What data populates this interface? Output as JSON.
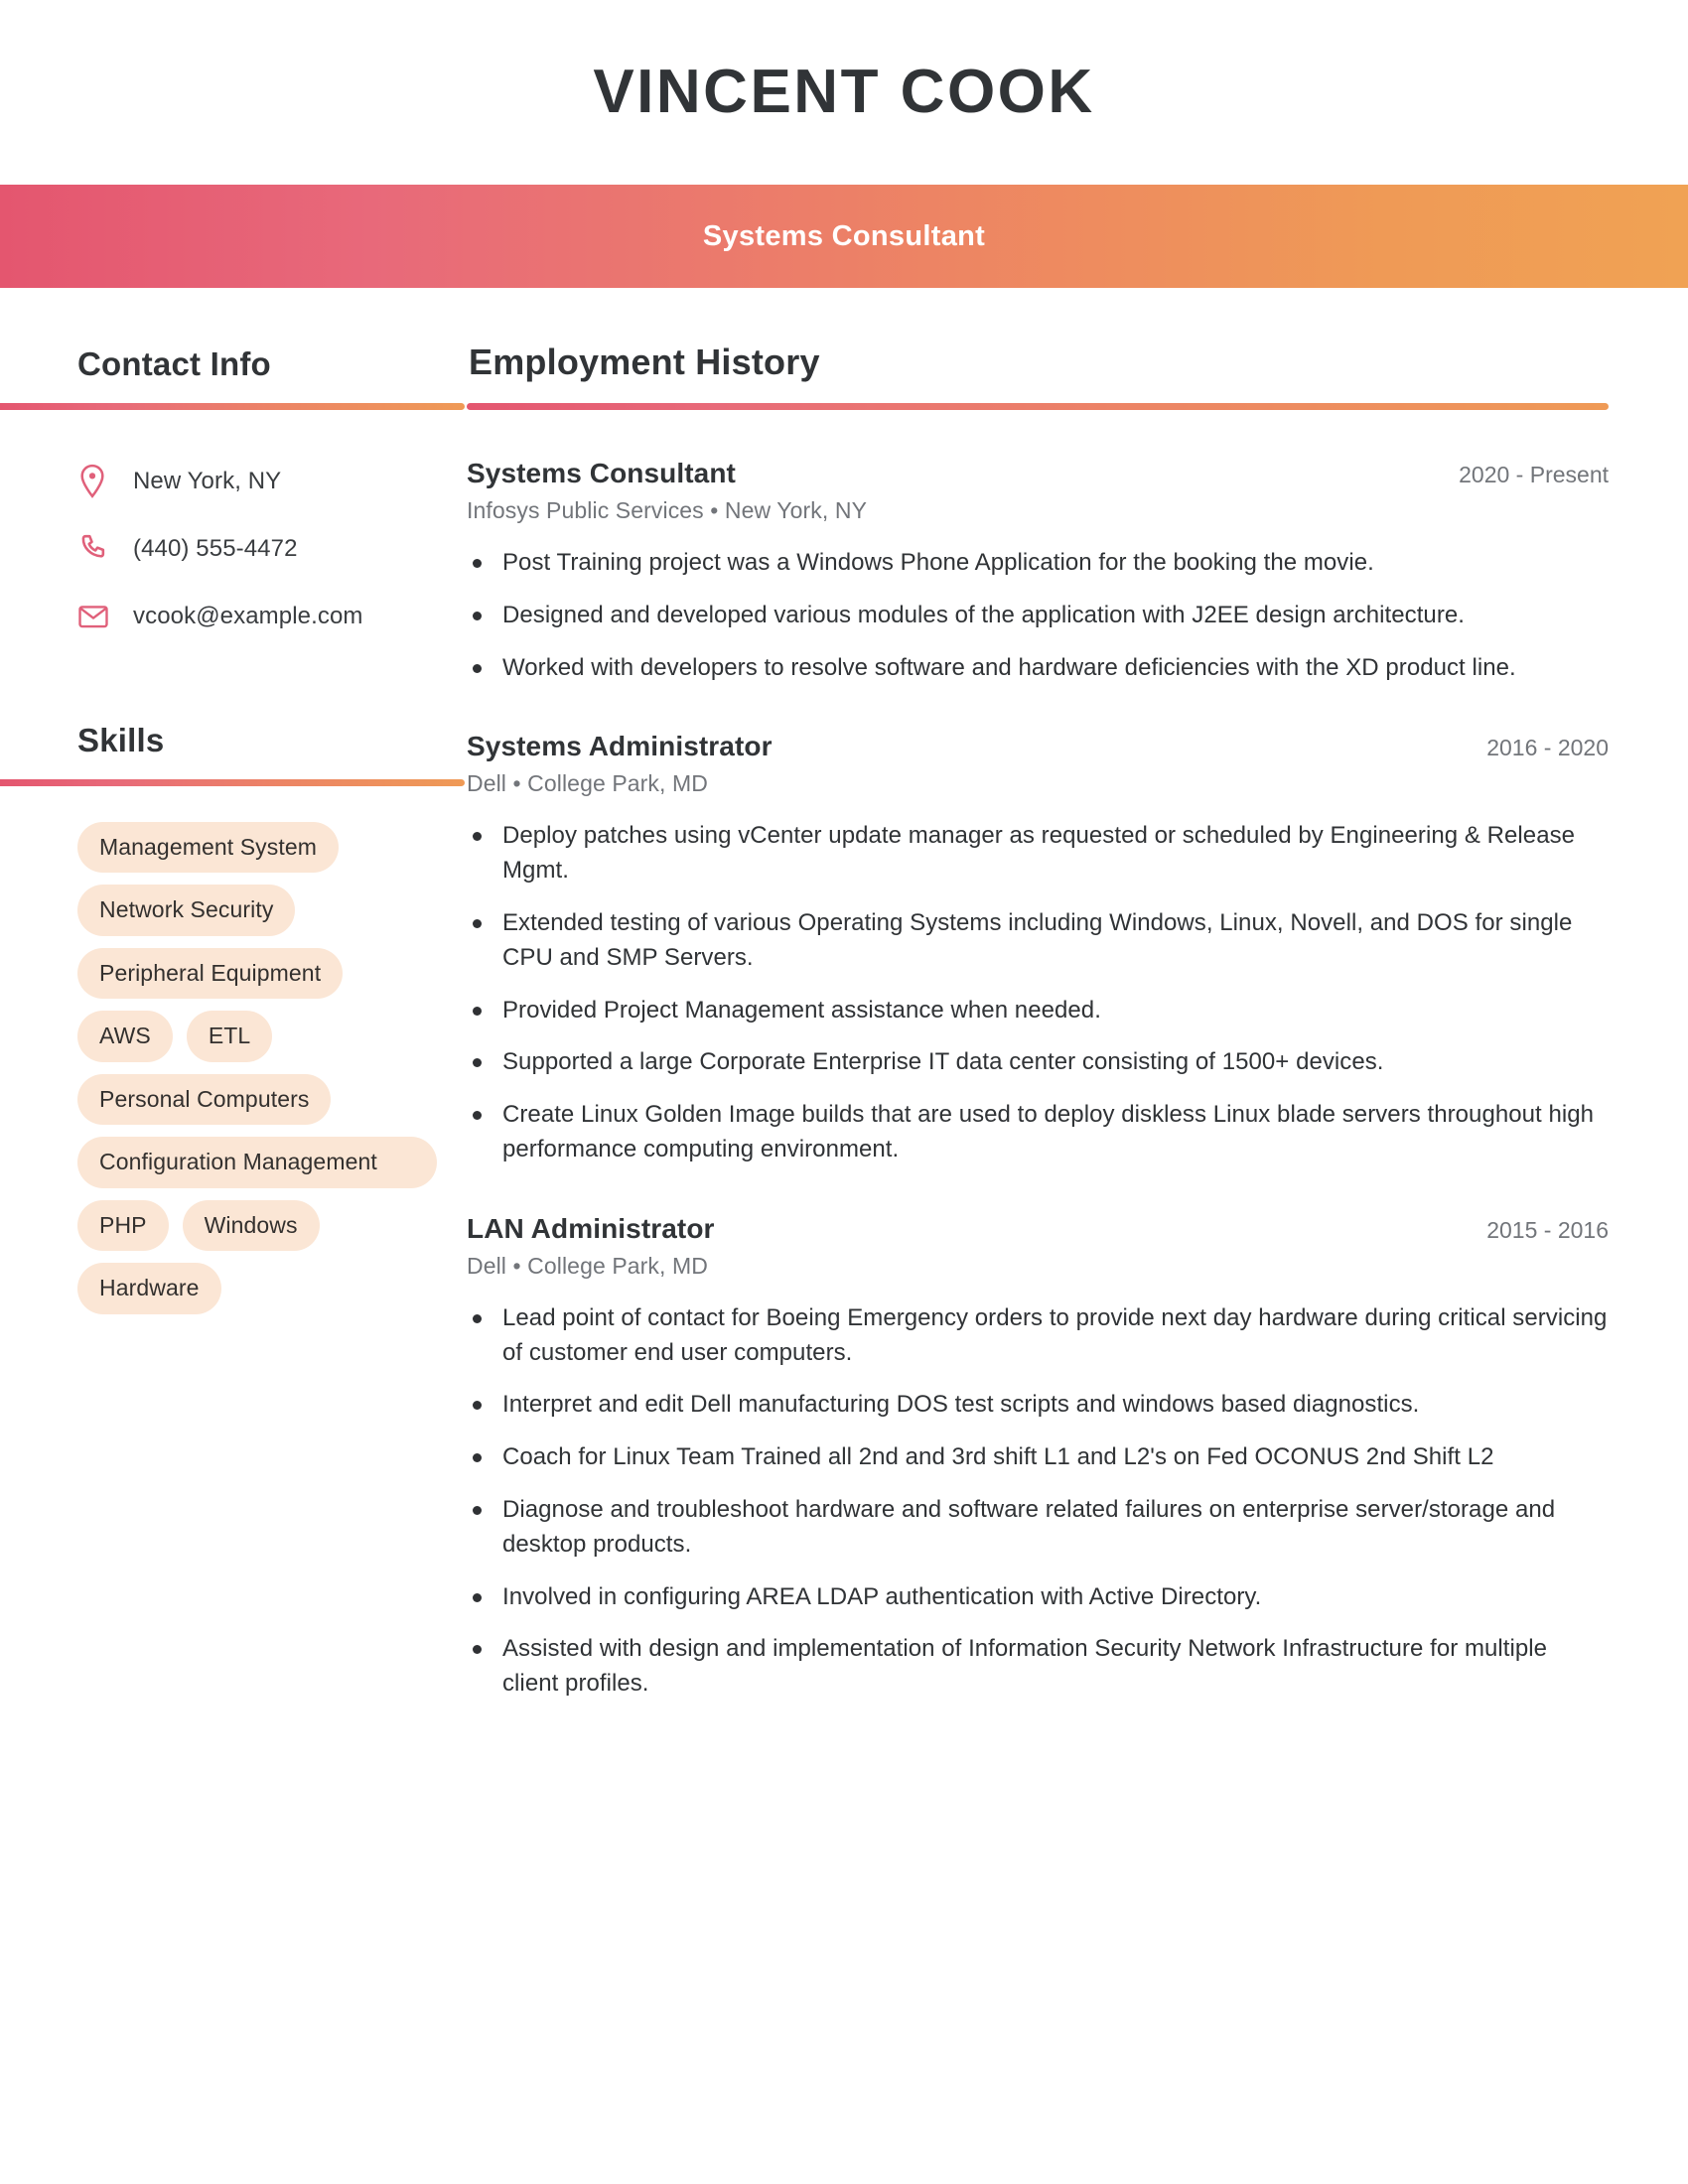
{
  "header": {
    "full_name": "VINCENT COOK",
    "job_title": "Systems Consultant"
  },
  "theme": {
    "gradient_start": "#e4566f",
    "gradient_end": "#f0a254",
    "icon_color": "#e0607a",
    "pill_bg": "#fbe6d5",
    "heading_color": "#313437",
    "muted_text": "#72757a"
  },
  "sidebar": {
    "contact": {
      "heading": "Contact Info",
      "items": [
        {
          "icon": "location-pin-icon",
          "text": "New York, NY"
        },
        {
          "icon": "phone-icon",
          "text": "(440) 555-4472"
        },
        {
          "icon": "envelope-icon",
          "text": "vcook@example.com"
        }
      ]
    },
    "skills": {
      "heading": "Skills",
      "items": [
        {
          "label": "Management System",
          "wide": false
        },
        {
          "label": "Network Security",
          "wide": false
        },
        {
          "label": "Peripheral Equipment",
          "wide": false
        },
        {
          "label": "AWS",
          "wide": false
        },
        {
          "label": "ETL",
          "wide": false
        },
        {
          "label": "Personal Computers",
          "wide": false
        },
        {
          "label": "Configuration Management",
          "wide": true
        },
        {
          "label": "PHP",
          "wide": false
        },
        {
          "label": "Windows",
          "wide": false
        },
        {
          "label": "Hardware",
          "wide": false
        }
      ]
    }
  },
  "main": {
    "heading": "Employment History",
    "jobs": [
      {
        "role": "Systems Consultant",
        "dates": "2020 - Present",
        "company": "Infosys Public Services",
        "separator": "•",
        "location": "New York, NY",
        "meta": "Infosys Public Services  •  New York, NY",
        "bullets": [
          "Post Training project was a Windows Phone Application for the booking the movie.",
          "Designed and developed various modules of the application with J2EE design architecture.",
          "Worked with developers to resolve software and hardware deficiencies with the XD product line."
        ]
      },
      {
        "role": "Systems Administrator",
        "dates": "2016 - 2020",
        "company": "Dell",
        "separator": "•",
        "location": "College Park, MD",
        "meta": "Dell  •  College Park, MD",
        "bullets": [
          "Deploy patches using vCenter update manager as requested or scheduled by Engineering & Release Mgmt.",
          "Extended testing of various Operating Systems including Windows, Linux, Novell, and DOS for single CPU and SMP Servers.",
          "Provided Project Management assistance when needed.",
          "Supported a large Corporate Enterprise IT data center consisting of 1500+ devices.",
          "Create Linux Golden Image builds that are used to deploy diskless Linux blade servers throughout high performance computing environment."
        ]
      },
      {
        "role": "LAN Administrator",
        "dates": "2015 - 2016",
        "company": "Dell",
        "separator": "•",
        "location": "College Park, MD",
        "meta": "Dell  •  College Park, MD",
        "bullets": [
          "Lead point of contact for Boeing Emergency orders to provide next day hardware during critical servicing of customer end user computers.",
          "Interpret and edit Dell manufacturing DOS test scripts and windows based diagnostics.",
          "Coach for Linux Team Trained all 2nd and 3rd shift L1 and L2's on Fed OCONUS 2nd Shift L2",
          "Diagnose and troubleshoot hardware and software related failures on enterprise server/storage and desktop products.",
          "Involved in configuring AREA LDAP authentication with Active Directory.",
          "Assisted with design and implementation of Information Security Network Infrastructure for multiple client profiles."
        ]
      }
    ]
  }
}
